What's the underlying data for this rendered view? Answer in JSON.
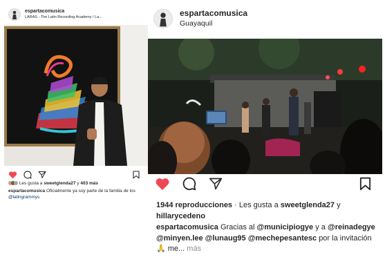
{
  "left_post": {
    "username": "espartacomusica",
    "location": "LARAS - The Latin Recording Academy / La...",
    "likes_prefix": "Les gusta a",
    "likes_user": "sweetglenda27",
    "likes_connector": "y",
    "likes_count": "403 más",
    "caption_user": "espartacomusica",
    "caption_text": "Oficialmente ya soy parte de la familia de los",
    "caption_tag": "@latingrammys"
  },
  "right_post": {
    "username": "espartacomusica",
    "location": "Guayaquil",
    "views": "1944 reproducciones",
    "likes_prefix": "· Les gusta a",
    "likes_user1": "sweetglenda27",
    "likes_connector": "y",
    "likes_user2": "hillarycedeno",
    "caption_user": "espartacomusica",
    "caption_t1": "Gracias al",
    "mention1": "@municipiogye",
    "caption_t2": "y a",
    "mention2": "@reinadegye",
    "mention3": "@minyen.lee",
    "mention4": "@lunaug95",
    "mention5": "@mechepesantesc",
    "caption_t3": "por la invitación",
    "caption_emoji": "🙏",
    "caption_t4": "me...",
    "more": "más"
  },
  "colors": {
    "like_red": "#ed4956",
    "text": "#262626",
    "muted": "#8e8e8e"
  }
}
